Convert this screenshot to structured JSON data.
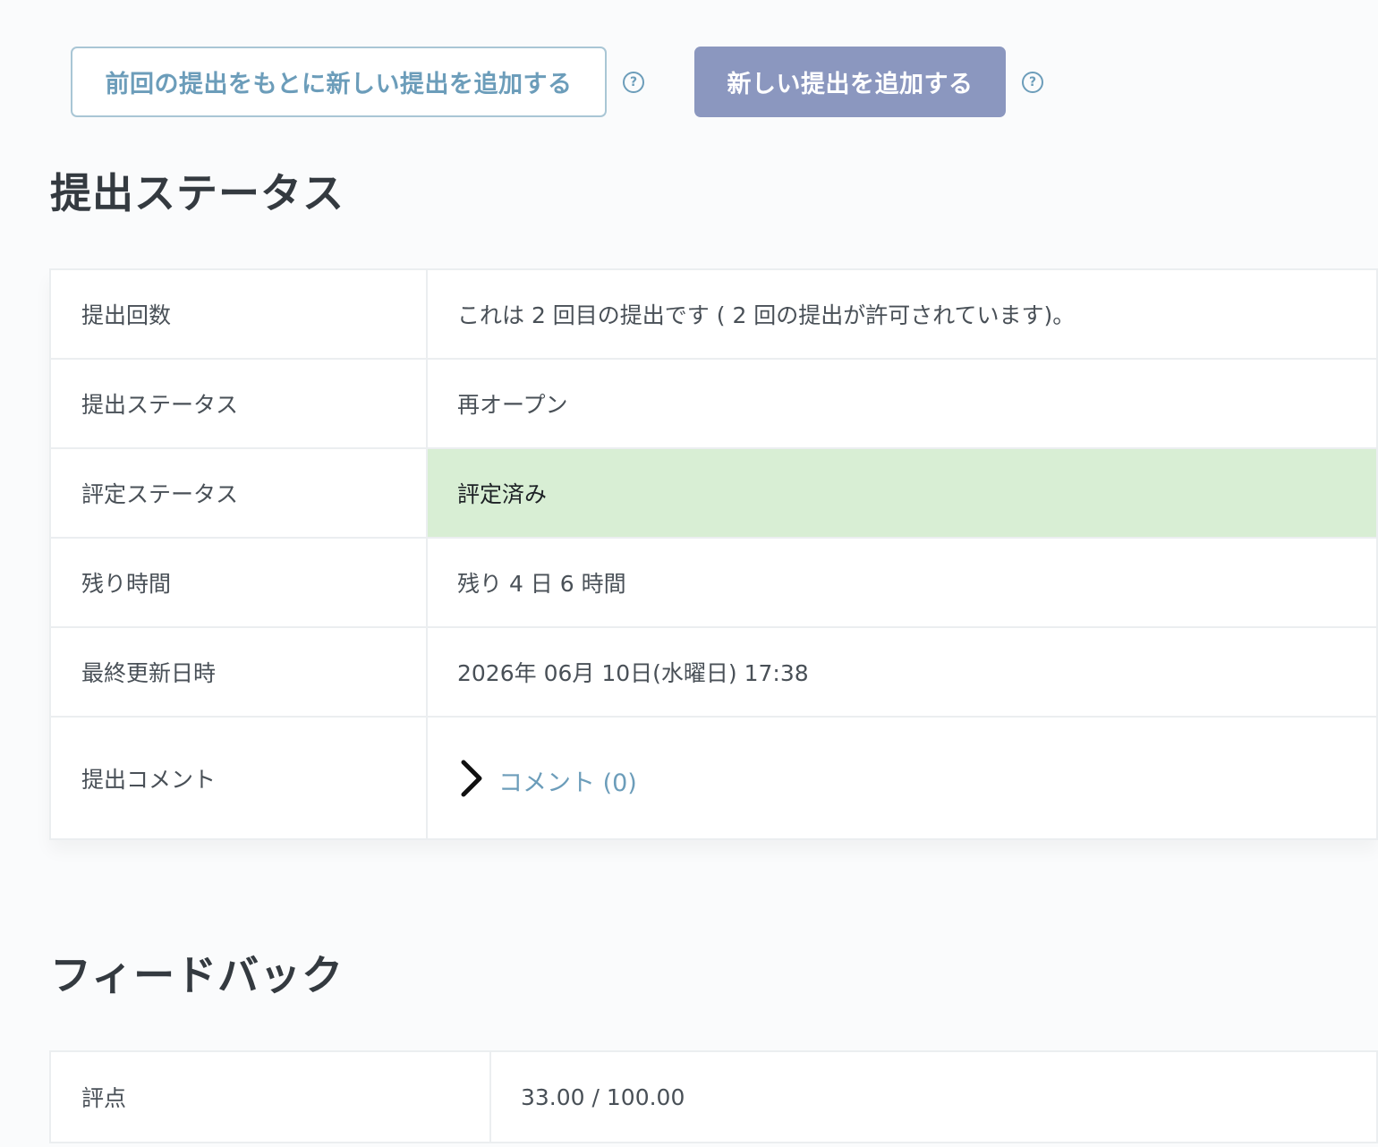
{
  "actions": {
    "based_on_previous_label": "前回の提出をもとに新しい提出を追加する",
    "add_new_label": "新しい提出を追加する",
    "help_glyph": "?"
  },
  "status_section": {
    "heading": "提出ステータス",
    "rows": [
      {
        "label": "提出回数",
        "value": "これは 2 回目の提出です ( 2 回の提出が許可されています)。"
      },
      {
        "label": "提出ステータス",
        "value": "再オープン"
      },
      {
        "label": "評定ステータス",
        "value": "評定済み"
      },
      {
        "label": "残り時間",
        "value": "残り 4 日 6 時間"
      },
      {
        "label": "最終更新日時",
        "value": "2026年 06月 10日(水曜日) 17:38"
      },
      {
        "label": "提出コメント",
        "value": "コメント (0)"
      }
    ]
  },
  "feedback_section": {
    "heading": "フィードバック",
    "rows": [
      {
        "label": "評点",
        "value": "33.00 / 100.00"
      }
    ]
  },
  "colors": {
    "accent": "#6c9dba",
    "primary_button": "#8b97bf",
    "graded_bg": "#d8eed4",
    "heading": "#343a40",
    "text": "#495057"
  },
  "icons": {
    "help": "question-circle-icon",
    "expand": "chevron-right-icon"
  }
}
